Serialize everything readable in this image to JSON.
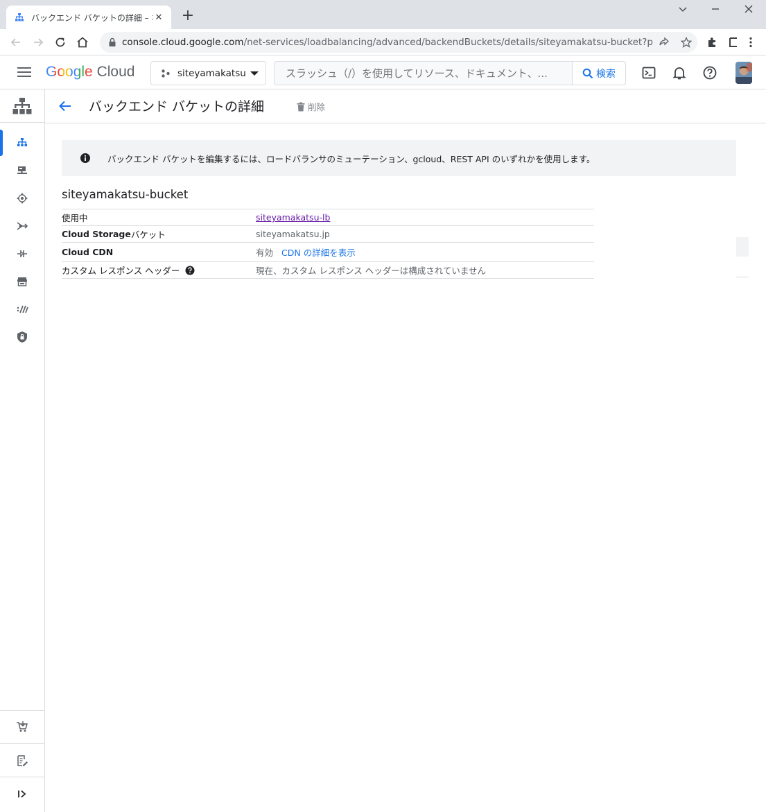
{
  "browser": {
    "tab_title": "バックエンド バケットの詳細 – ネットワ",
    "url_domain": "console.cloud.google.com",
    "url_path": "/net-services/loadbalancing/advanced/backendBuckets/details/siteyamakatsu-bucket?project=..."
  },
  "header": {
    "logo_google": "Google",
    "logo_cloud": "Cloud",
    "project_name": "siteyamakatsu",
    "search_placeholder": "スラッシュ（/）を使用してリソース、ドキュメント、...",
    "search_button": "検索"
  },
  "page": {
    "title": "バックエンド バケットの詳細",
    "delete_label": "削除",
    "banner_text": "バックエンド バケットを編集するには、ロードバランサのミューテーション、gcloud、REST API のいずれかを使用します。",
    "bucket_name": "siteyamakatsu-bucket"
  },
  "details": {
    "in_use_label": "使用中",
    "in_use_value": "siteyamakatsu-lb",
    "storage_label_bold": "Cloud Storage",
    "storage_label_rest": " バケット",
    "storage_value": "siteyamakatsu.jp",
    "cdn_label": "Cloud CDN",
    "cdn_status": "有効",
    "cdn_link": "CDN の詳細を表示",
    "headers_label": "カスタム レスポンス ヘッダー",
    "headers_value": "現在、カスタム レスポンス ヘッダーは構成されていません"
  },
  "colors": {
    "accent": "#1a73e8",
    "visited_link": "#681da8",
    "border": "#dadce0"
  }
}
